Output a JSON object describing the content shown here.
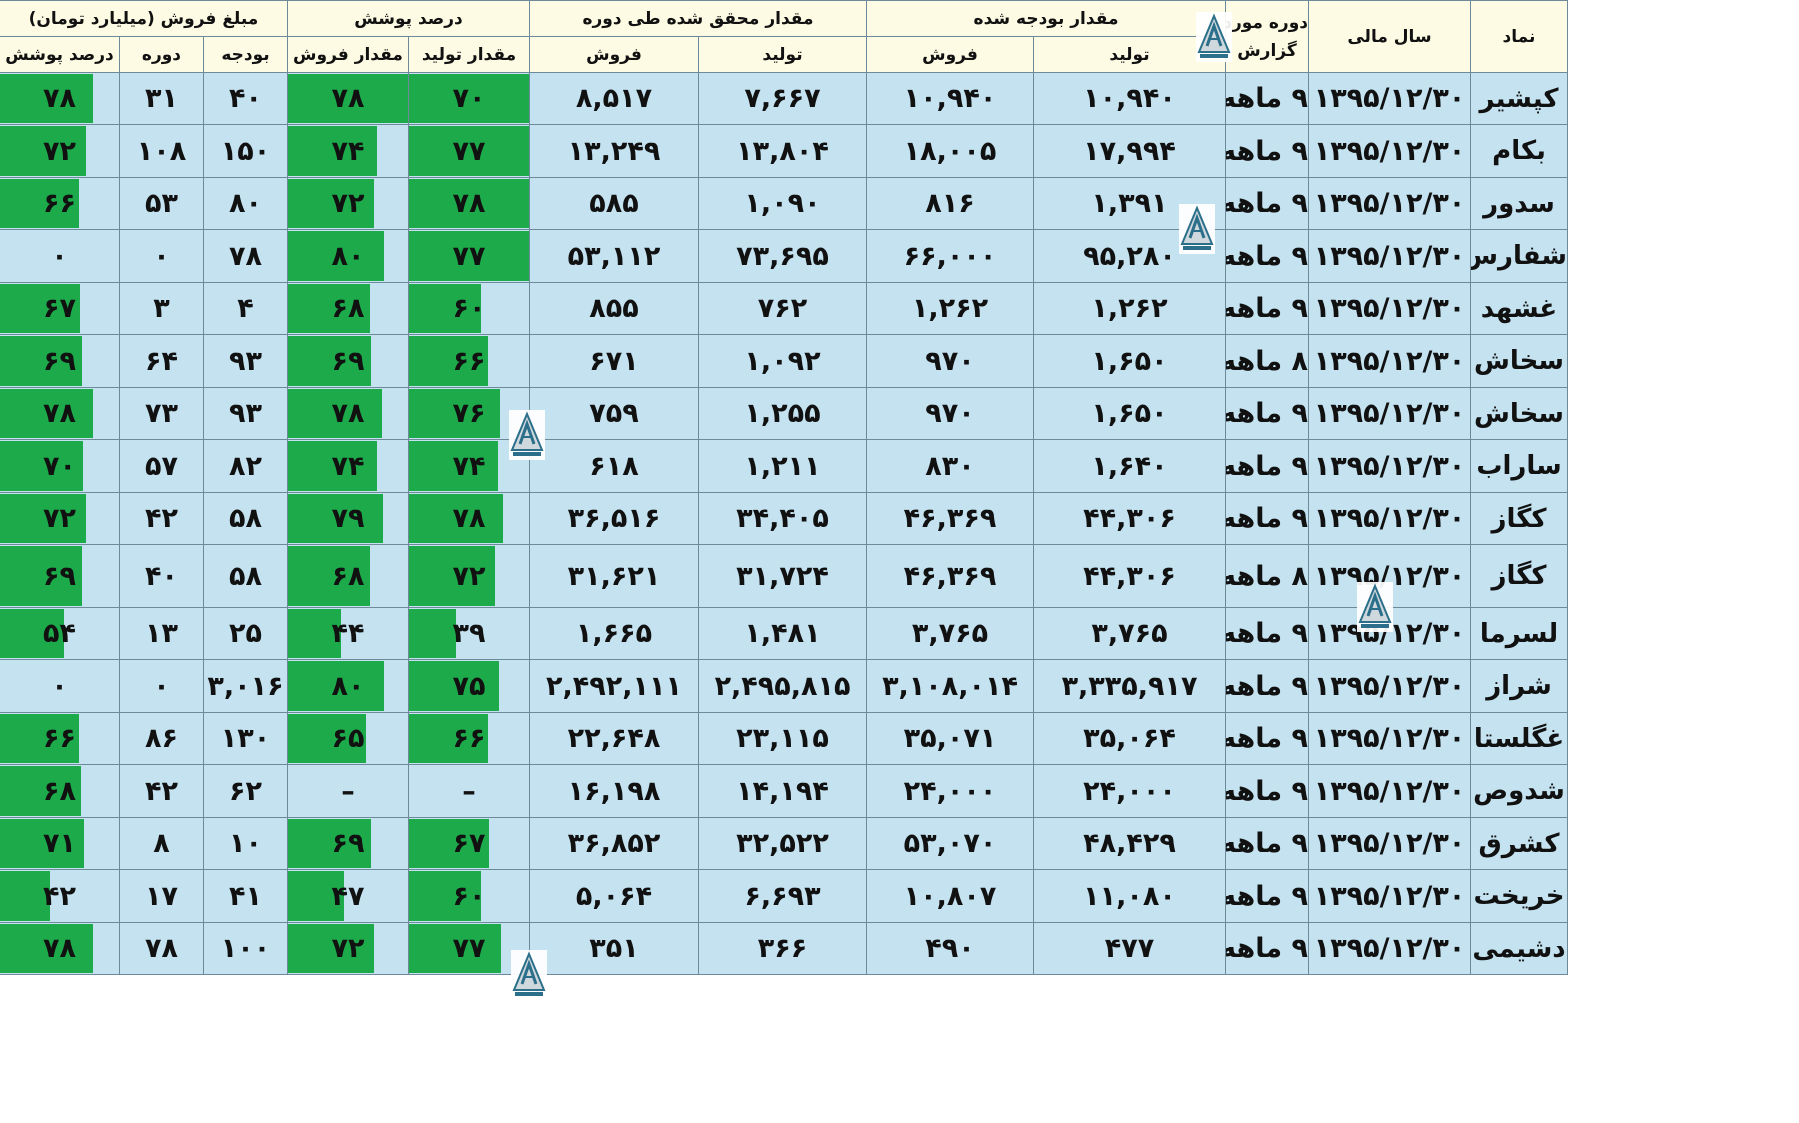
{
  "headers": {
    "symbol": "نماد",
    "fiscal_year": "سال مالی",
    "report_period_line1": "دوره مورد",
    "report_period_line2": "گزارش",
    "budgeted": "مقدار بودجه شده",
    "realized": "مقدار محقق شده طی دوره",
    "coverage_percent": "درصد پوشش",
    "sales_amount": "مبلغ فروش (میلیارد تومان)",
    "production": "تولید",
    "sales": "فروش",
    "production_qty": "مقدار تولید",
    "sales_qty": "مقدار فروش",
    "budget": "بودجه",
    "period": "دوره",
    "coverage": "درصد پوشش"
  },
  "colors": {
    "bar": "#1daa4a",
    "cell_bg": "#c4e2f0",
    "header_bg": "#fdfbe4"
  },
  "logo_icon": "triangle-logo-icon",
  "rows": [
    {
      "symbol": "کپشیر",
      "fiscal_year": "۱۳۹۵/۱۲/۳۰",
      "period": "۹ ماهه",
      "budget_prod": "۱۰,۹۴۰",
      "budget_sales": "۱۰,۹۴۰",
      "real_prod": "۷,۶۶۷",
      "real_sales": "۸,۵۱۷",
      "cov_prod": "۷۰",
      "cov_prod_pct": 100,
      "cov_sales": "۷۸",
      "cov_sales_pct": 100,
      "amt_budget": "۴۰",
      "amt_period": "۳۱",
      "amt_cov": "۷۸",
      "amt_cov_pct": 78
    },
    {
      "symbol": "بکام",
      "fiscal_year": "۱۳۹۵/۱۲/۳۰",
      "period": "۹ ماهه",
      "budget_prod": "۱۷,۹۹۴",
      "budget_sales": "۱۸,۰۰۵",
      "real_prod": "۱۳,۸۰۴",
      "real_sales": "۱۳,۲۴۹",
      "cov_prod": "۷۷",
      "cov_prod_pct": 100,
      "cov_sales": "۷۴",
      "cov_sales_pct": 74,
      "amt_budget": "۱۵۰",
      "amt_period": "۱۰۸",
      "amt_cov": "۷۲",
      "amt_cov_pct": 72
    },
    {
      "symbol": "سدور",
      "fiscal_year": "۱۳۹۵/۱۲/۳۰",
      "period": "۹ ماهه",
      "budget_prod": "۱,۳۹۱",
      "budget_sales": "۸۱۶",
      "real_prod": "۱,۰۹۰",
      "real_sales": "۵۸۵",
      "cov_prod": "۷۸",
      "cov_prod_pct": 100,
      "cov_sales": "۷۲",
      "cov_sales_pct": 72,
      "amt_budget": "۸۰",
      "amt_period": "۵۳",
      "amt_cov": "۶۶",
      "amt_cov_pct": 66
    },
    {
      "symbol": "شفارس",
      "fiscal_year": "۱۳۹۵/۱۲/۳۰",
      "period": "۹ ماهه",
      "budget_prod": "۹۵,۲۸۰",
      "budget_sales": "۶۶,۰۰۰",
      "real_prod": "۷۳,۶۹۵",
      "real_sales": "۵۳,۱۱۲",
      "cov_prod": "۷۷",
      "cov_prod_pct": 100,
      "cov_sales": "۸۰",
      "cov_sales_pct": 80,
      "amt_budget": "۷۸",
      "amt_period": "۰",
      "amt_cov": "۰",
      "amt_cov_pct": 0
    },
    {
      "symbol": "غشهد",
      "fiscal_year": "۱۳۹۵/۱۲/۳۰",
      "period": "۹ ماهه",
      "budget_prod": "۱,۲۶۲",
      "budget_sales": "۱,۲۶۲",
      "real_prod": "۷۶۲",
      "real_sales": "۸۵۵",
      "cov_prod": "۶۰",
      "cov_prod_pct": 60,
      "cov_sales": "۶۸",
      "cov_sales_pct": 68,
      "amt_budget": "۴",
      "amt_period": "۳",
      "amt_cov": "۶۷",
      "amt_cov_pct": 67
    },
    {
      "symbol": "سخاش",
      "fiscal_year": "۱۳۹۵/۱۲/۳۰",
      "period": "۸ ماهه",
      "budget_prod": "۱,۶۵۰",
      "budget_sales": "۹۷۰",
      "real_prod": "۱,۰۹۲",
      "real_sales": "۶۷۱",
      "cov_prod": "۶۶",
      "cov_prod_pct": 66,
      "cov_sales": "۶۹",
      "cov_sales_pct": 69,
      "amt_budget": "۹۳",
      "amt_period": "۶۴",
      "amt_cov": "۶۹",
      "amt_cov_pct": 69
    },
    {
      "symbol": "سخاش",
      "fiscal_year": "۱۳۹۵/۱۲/۳۰",
      "period": "۹ ماهه",
      "budget_prod": "۱,۶۵۰",
      "budget_sales": "۹۷۰",
      "real_prod": "۱,۲۵۵",
      "real_sales": "۷۵۹",
      "cov_prod": "۷۶",
      "cov_prod_pct": 76,
      "cov_sales": "۷۸",
      "cov_sales_pct": 78,
      "amt_budget": "۹۳",
      "amt_period": "۷۳",
      "amt_cov": "۷۸",
      "amt_cov_pct": 78
    },
    {
      "symbol": "ساراب",
      "fiscal_year": "۱۳۹۵/۱۲/۳۰",
      "period": "۹ ماهه",
      "budget_prod": "۱,۶۴۰",
      "budget_sales": "۸۳۰",
      "real_prod": "۱,۲۱۱",
      "real_sales": "۶۱۸",
      "cov_prod": "۷۴",
      "cov_prod_pct": 74,
      "cov_sales": "۷۴",
      "cov_sales_pct": 74,
      "amt_budget": "۸۲",
      "amt_period": "۵۷",
      "amt_cov": "۷۰",
      "amt_cov_pct": 70
    },
    {
      "symbol": "کگاز",
      "fiscal_year": "۱۳۹۵/۱۲/۳۰",
      "period": "۹ ماهه",
      "budget_prod": "۴۴,۳۰۶",
      "budget_sales": "۴۶,۳۶۹",
      "real_prod": "۳۴,۴۰۵",
      "real_sales": "۳۶,۵۱۶",
      "cov_prod": "۷۸",
      "cov_prod_pct": 78,
      "cov_sales": "۷۹",
      "cov_sales_pct": 79,
      "amt_budget": "۵۸",
      "amt_period": "۴۲",
      "amt_cov": "۷۲",
      "amt_cov_pct": 72
    },
    {
      "symbol": "کگاز",
      "fiscal_year": "۱۳۹۵/۱۲/۳۰",
      "period": "۸ ماهه",
      "budget_prod": "۴۴,۳۰۶",
      "budget_sales": "۴۶,۳۶۹",
      "real_prod": "۳۱,۷۲۴",
      "real_sales": "۳۱,۶۲۱",
      "cov_prod": "۷۲",
      "cov_prod_pct": 72,
      "cov_sales": "۶۸",
      "cov_sales_pct": 68,
      "amt_budget": "۵۸",
      "amt_period": "۴۰",
      "amt_cov": "۶۹",
      "amt_cov_pct": 69
    },
    {
      "symbol": "لسرما",
      "fiscal_year": "۱۳۹۵/۱۲/۳۰",
      "period": "۹ ماهه",
      "budget_prod": "۳,۷۶۵",
      "budget_sales": "۳,۷۶۵",
      "real_prod": "۱,۴۸۱",
      "real_sales": "۱,۶۶۵",
      "cov_prod": "۳۹",
      "cov_prod_pct": 39,
      "cov_sales": "۴۴",
      "cov_sales_pct": 44,
      "amt_budget": "۲۵",
      "amt_period": "۱۳",
      "amt_cov": "۵۴",
      "amt_cov_pct": 54
    },
    {
      "symbol": "شراز",
      "fiscal_year": "۱۳۹۵/۱۲/۳۰",
      "period": "۹ ماهه",
      "budget_prod": "۳,۳۳۵,۹۱۷",
      "budget_sales": "۳,۱۰۸,۰۱۴",
      "real_prod": "۲,۴۹۵,۸۱۵",
      "real_sales": "۲,۴۹۲,۱۱۱",
      "cov_prod": "۷۵",
      "cov_prod_pct": 75,
      "cov_sales": "۸۰",
      "cov_sales_pct": 80,
      "amt_budget": "۳,۰۱۶",
      "amt_period": "۰",
      "amt_cov": "۰",
      "amt_cov_pct": 0
    },
    {
      "symbol": "غگلستا",
      "fiscal_year": "۱۳۹۵/۱۲/۳۰",
      "period": "۹ ماهه",
      "budget_prod": "۳۵,۰۶۴",
      "budget_sales": "۳۵,۰۷۱",
      "real_prod": "۲۳,۱۱۵",
      "real_sales": "۲۲,۶۴۸",
      "cov_prod": "۶۶",
      "cov_prod_pct": 66,
      "cov_sales": "۶۵",
      "cov_sales_pct": 65,
      "amt_budget": "۱۳۰",
      "amt_period": "۸۶",
      "amt_cov": "۶۶",
      "amt_cov_pct": 66
    },
    {
      "symbol": "شدوص",
      "fiscal_year": "۱۳۹۵/۱۲/۳۰",
      "period": "۹ ماهه",
      "budget_prod": "۲۴,۰۰۰",
      "budget_sales": "۲۴,۰۰۰",
      "real_prod": "۱۴,۱۹۴",
      "real_sales": "۱۶,۱۹۸",
      "cov_prod": "–",
      "cov_prod_pct": 0,
      "cov_sales": "–",
      "cov_sales_pct": 0,
      "amt_budget": "۶۲",
      "amt_period": "۴۲",
      "amt_cov": "۶۸",
      "amt_cov_pct": 68
    },
    {
      "symbol": "کشرق",
      "fiscal_year": "۱۳۹۵/۱۲/۳۰",
      "period": "۹ ماهه",
      "budget_prod": "۴۸,۴۲۹",
      "budget_sales": "۵۳,۰۷۰",
      "real_prod": "۳۲,۵۲۲",
      "real_sales": "۳۶,۸۵۲",
      "cov_prod": "۶۷",
      "cov_prod_pct": 67,
      "cov_sales": "۶۹",
      "cov_sales_pct": 69,
      "amt_budget": "۱۰",
      "amt_period": "۸",
      "amt_cov": "۷۱",
      "amt_cov_pct": 71
    },
    {
      "symbol": "خریخت",
      "fiscal_year": "۱۳۹۵/۱۲/۳۰",
      "period": "۹ ماهه",
      "budget_prod": "۱۱,۰۸۰",
      "budget_sales": "۱۰,۸۰۷",
      "real_prod": "۶,۶۹۳",
      "real_sales": "۵,۰۶۴",
      "cov_prod": "۶۰",
      "cov_prod_pct": 60,
      "cov_sales": "۴۷",
      "cov_sales_pct": 47,
      "amt_budget": "۴۱",
      "amt_period": "۱۷",
      "amt_cov": "۴۲",
      "amt_cov_pct": 42
    },
    {
      "symbol": "دشیمی",
      "fiscal_year": "۱۳۹۵/۱۲/۳۰",
      "period": "۹ ماهه",
      "budget_prod": "۴۷۷",
      "budget_sales": "۴۹۰",
      "real_prod": "۳۶۶",
      "real_sales": "۳۵۱",
      "cov_prod": "۷۷",
      "cov_prod_pct": 77,
      "cov_sales": "۷۲",
      "cov_sales_pct": 72,
      "amt_budget": "۱۰۰",
      "amt_period": "۷۸",
      "amt_cov": "۷۸",
      "amt_cov_pct": 78
    }
  ]
}
